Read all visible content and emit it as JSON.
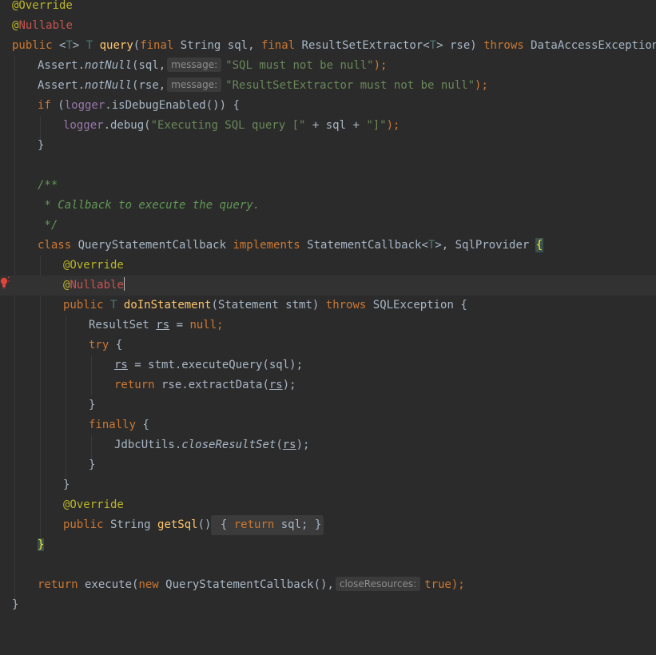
{
  "editor": {
    "lines": {
      "l1": {
        "a": "@Override"
      },
      "l2": {
        "a": "@",
        "b": "Nullable"
      },
      "l3": {
        "kw1": "public",
        "p1": " <",
        "t1": "T",
        "p2": "> ",
        "t2": "T",
        "p3": " ",
        "m": "query",
        "p4": "(",
        "kw2": "final",
        "p5": " String sql, ",
        "kw3": "final",
        "p6": " ResultSetExtractor<",
        "t3": "T",
        "p7": "> rse) ",
        "kw4": "throws",
        "p8": " DataAccessException {"
      },
      "l4": {
        "p1": "Assert.",
        "m": "notNull",
        "p2": "(sql,",
        "hint": "message:",
        "s": "\"SQL must not be null\"",
        "p3": ");"
      },
      "l5": {
        "p1": "Assert.",
        "m": "notNull",
        "p2": "(rse,",
        "hint": "message:",
        "s": "\"ResultSetExtractor must not be null\"",
        "p3": ");"
      },
      "l6": {
        "kw": "if",
        "p1": " (",
        "f": "logger",
        "p2": ".isDebugEnabled()) {"
      },
      "l7": {
        "f": "logger",
        "p1": ".debug(",
        "s1": "\"Executing SQL query [\"",
        "p2": " + sql + ",
        "s2": "\"]\"",
        "p3": ");"
      },
      "l8": {
        "a": "}"
      },
      "l10": {
        "a": "/**"
      },
      "l11": {
        "a": " * Callback to execute the query."
      },
      "l12": {
        "a": " */"
      },
      "l13": {
        "kw1": "class",
        "p1": " QueryStatementCallback ",
        "kw2": "implements",
        "p2": " StatementCallback<",
        "t": "T",
        "p3": ">, SqlProvider ",
        "b": "{"
      },
      "l14": {
        "a": "@Override"
      },
      "l15": {
        "a": "@",
        "b": "Nullable"
      },
      "l16": {
        "kw1": "public",
        "p1": " ",
        "t": "T",
        "p2": " ",
        "m": "doInStatement",
        "p3": "(Statement stmt) ",
        "kw2": "throws",
        "p4": " SQLException {"
      },
      "l17": {
        "p1": "ResultSet ",
        "v": "rs",
        "p2": " = ",
        "kw": "null",
        "p3": ";"
      },
      "l18": {
        "kw": "try",
        "p1": " {"
      },
      "l19": {
        "v": "rs",
        "p1": " = stmt.executeQuery(sql);"
      },
      "l20": {
        "kw": "return",
        "p1": " rse.extractData(",
        "v": "rs",
        "p2": ");"
      },
      "l21": {
        "a": "}"
      },
      "l22": {
        "kw": "finally",
        "p1": " {"
      },
      "l23": {
        "p1": "JdbcUtils.",
        "m": "closeResultSet",
        "p2": "(",
        "v": "rs",
        "p3": ");"
      },
      "l24": {
        "a": "}"
      },
      "l25": {
        "a": "}"
      },
      "l26": {
        "a": "@Override"
      },
      "l27": {
        "kw1": "public",
        "p1": " String ",
        "m": "getSql",
        "p2": "()",
        "f1": " { ",
        "kw2": "return",
        "f2": " sql; }"
      },
      "l28": {
        "b": "}"
      },
      "l30": {
        "kw1": "return",
        "p1": " execute(",
        "kw2": "new",
        "p2": " QueryStatementCallback(),",
        "hint": "closeResources:",
        "kw3": "true",
        "p3": ");"
      },
      "l31": {
        "a": "}"
      }
    },
    "gutter_icon": "lightbulb-error-icon",
    "colors": {
      "background": "#2b2b2b",
      "keyword": "#cc7832",
      "annotation": "#bbb529",
      "string": "#6a8759",
      "field": "#9876aa",
      "method": "#ffc66d",
      "comment": "#629755"
    }
  }
}
